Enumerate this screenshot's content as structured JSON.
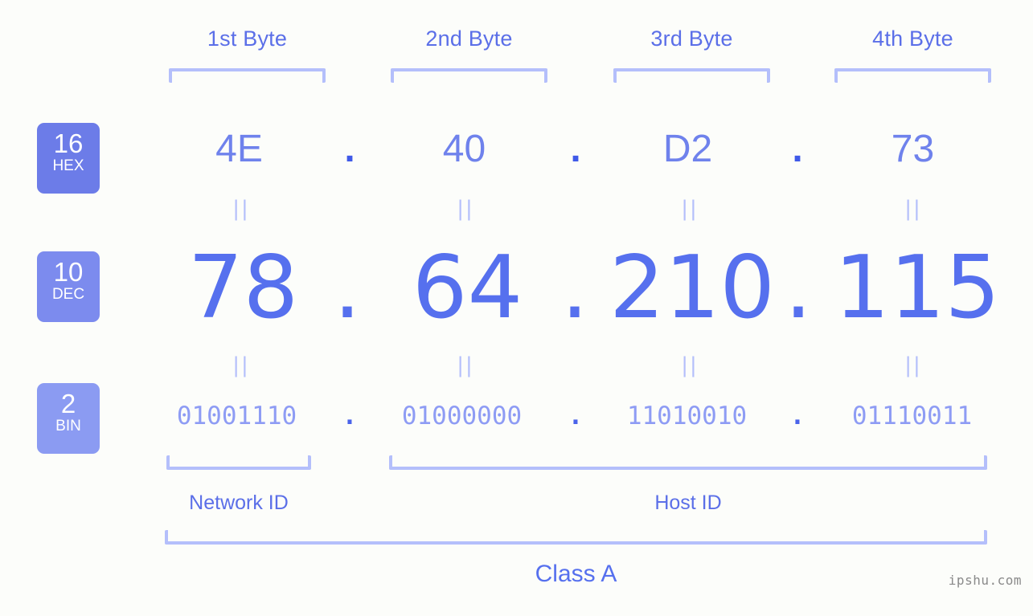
{
  "background_color": "#fcfdfa",
  "accent_color": "#5670ee",
  "bracket_color": "#b4bffb",
  "byte_headers": [
    {
      "label": "1st Byte"
    },
    {
      "label": "2nd Byte"
    },
    {
      "label": "3rd Byte"
    },
    {
      "label": "4th Byte"
    }
  ],
  "rows": [
    {
      "badge_number": "16",
      "badge_name": "HEX",
      "badge_color": "#6c7ce8",
      "values": [
        "4E",
        "40",
        "D2",
        "73"
      ],
      "separator": "."
    },
    {
      "badge_number": "10",
      "badge_name": "DEC",
      "badge_color": "#7c8bee",
      "values": [
        "78",
        "64",
        "210",
        "115"
      ],
      "separator": "."
    },
    {
      "badge_number": "2",
      "badge_name": "BIN",
      "badge_color": "#8b9bf2",
      "values": [
        "01001110",
        "01000000",
        "11010010",
        "01110011"
      ],
      "separator": "."
    }
  ],
  "equivalence_mark": "||",
  "sections": [
    {
      "label": "Network ID"
    },
    {
      "label": "Host ID"
    }
  ],
  "class_label": "Class A",
  "watermark": "ipshu.com",
  "chart_data": {
    "type": "table",
    "title": "IP address representation 78.64.210.115",
    "ip_decimal": "78.64.210.115",
    "ip_hex": "4E.40.D2.73",
    "ip_binary": "01001110.01000000.11010010.01110011",
    "bases": [
      "16",
      "10",
      "2"
    ],
    "base_names": [
      "HEX",
      "DEC",
      "BIN"
    ],
    "columns": [
      "1st Byte",
      "2nd Byte",
      "3rd Byte",
      "4th Byte"
    ],
    "rows": [
      [
        "4E",
        "40",
        "D2",
        "73"
      ],
      [
        "78",
        "64",
        "210",
        "115"
      ],
      [
        "01001110",
        "01000000",
        "11010010",
        "01110011"
      ]
    ],
    "network_id_bytes": 1,
    "host_id_bytes": 3,
    "ip_class": "Class A"
  }
}
